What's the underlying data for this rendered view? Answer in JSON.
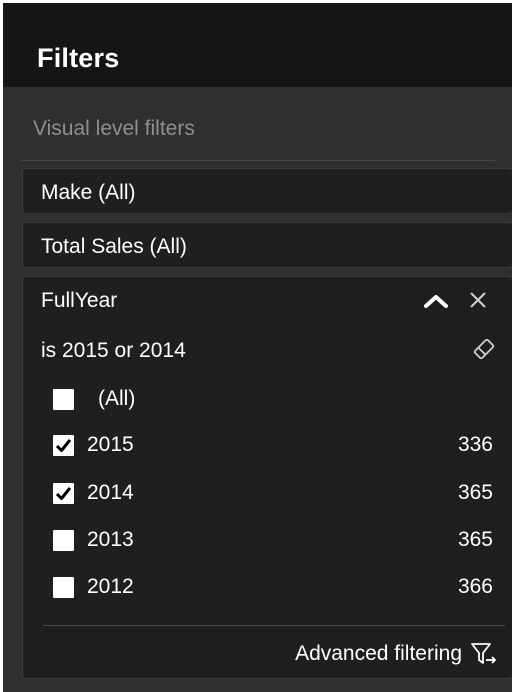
{
  "header": {
    "title": "Filters"
  },
  "section": {
    "label": "Visual level filters"
  },
  "filters": {
    "make": {
      "label": "Make (All)"
    },
    "total_sales": {
      "label": "Total Sales (All)"
    },
    "full_year": {
      "title": "FullYear",
      "condition": "is 2015 or 2014",
      "options": [
        {
          "label": "(All)",
          "count": "",
          "checked": false
        },
        {
          "label": "2015",
          "count": "336",
          "checked": true
        },
        {
          "label": "2014",
          "count": "365",
          "checked": true
        },
        {
          "label": "2013",
          "count": "365",
          "checked": false
        },
        {
          "label": "2012",
          "count": "366",
          "checked": false
        }
      ],
      "advanced_label": "Advanced filtering"
    }
  },
  "icons": {
    "collapse": "chevron-up-icon",
    "remove": "close-icon",
    "clear": "eraser-icon",
    "advanced": "filter-arrow-icon"
  },
  "colors": {
    "header_bg": "#151515",
    "pane_bg": "#2f2f2f",
    "card_bg": "#1f1f1f",
    "text": "#ffffff",
    "muted_text": "#8f8f8f"
  }
}
